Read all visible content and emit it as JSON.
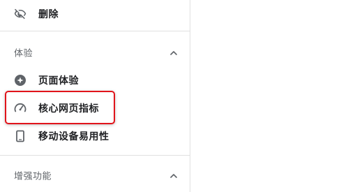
{
  "sidebar": {
    "top_item": {
      "label": "删除",
      "icon": "eye-off-icon"
    },
    "sections": [
      {
        "title": "体验",
        "expanded": true,
        "items": [
          {
            "label": "页面体验",
            "icon": "plus-circle-icon"
          },
          {
            "label": "核心网页指标",
            "icon": "gauge-icon",
            "highlighted": true
          },
          {
            "label": "移动设备易用性",
            "icon": "smartphone-icon"
          }
        ]
      },
      {
        "title": "增强功能",
        "expanded": true
      }
    ]
  },
  "colors": {
    "highlight_border": "#e1141b",
    "icon": "#5f6368",
    "divider": "#e0e0e0"
  }
}
